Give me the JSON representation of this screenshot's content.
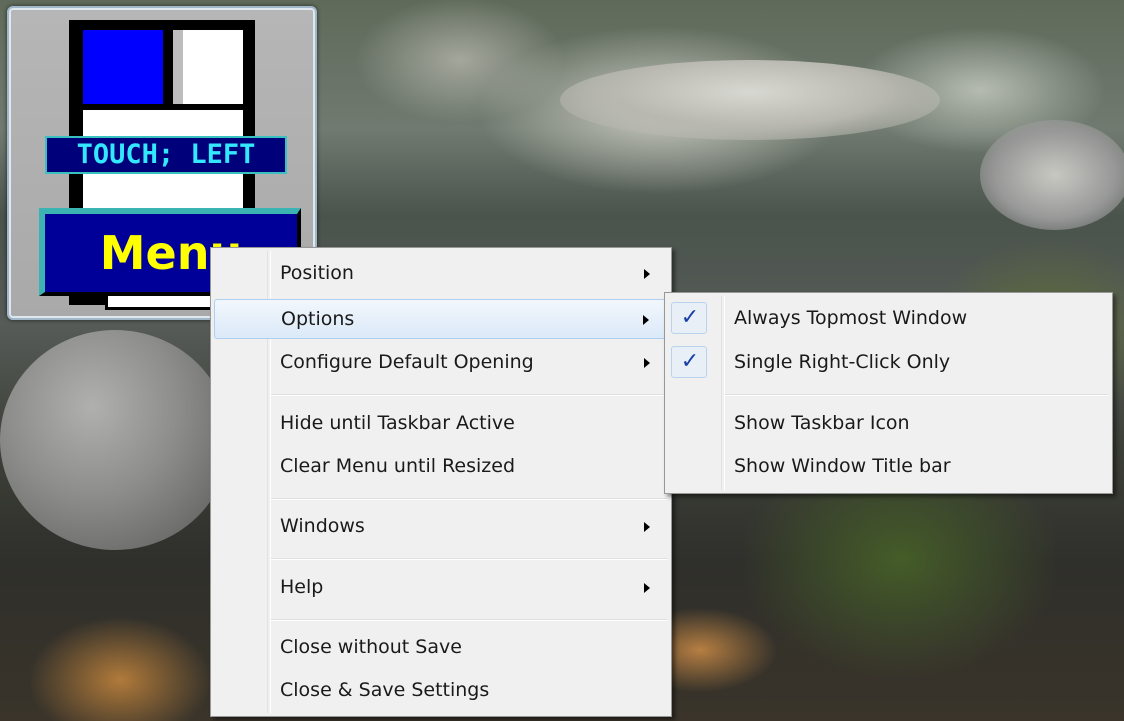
{
  "gadget": {
    "touch_label": "TOUCH; LEFT",
    "menu_button": "Menu"
  },
  "main_menu": {
    "items": [
      {
        "label": "Position",
        "submenu": true
      },
      {
        "label": "Options",
        "submenu": true,
        "highlighted": true
      },
      {
        "label": "Configure Default Opening",
        "submenu": true
      },
      {
        "label": "Hide until Taskbar Active",
        "submenu": false
      },
      {
        "label": "Clear Menu until Resized",
        "submenu": false
      },
      {
        "label": "Windows",
        "submenu": true
      },
      {
        "label": "Help",
        "submenu": true
      },
      {
        "label": "Close without Save",
        "submenu": false
      },
      {
        "label": "Close & Save Settings",
        "submenu": false
      }
    ]
  },
  "options_submenu": {
    "items": [
      {
        "label": "Always Topmost Window",
        "checked": true
      },
      {
        "label": "Single Right-Click Only",
        "checked": true
      },
      {
        "label": "Show Taskbar Icon",
        "checked": false
      },
      {
        "label": "Show Window Title bar",
        "checked": false
      }
    ],
    "check_glyph": "✓"
  },
  "colors": {
    "menu_background": "#f0f0f0",
    "highlight": "#dbe9f8",
    "check": "#1b3fa7",
    "gadget_blue": "#0000ff",
    "gadget_menu_text": "#ffff00",
    "gadget_touch_text": "#33e7ff"
  }
}
